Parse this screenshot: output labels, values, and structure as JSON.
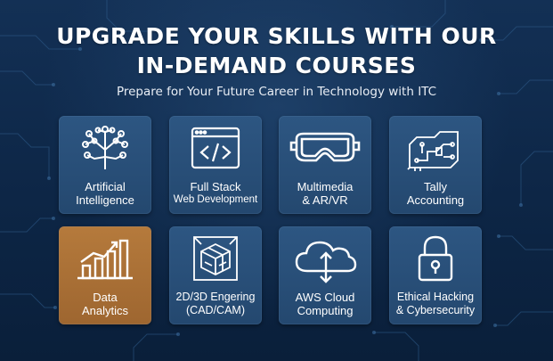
{
  "header": {
    "title_line1": "UPGRADE YOUR SKILLS WITH OUR",
    "title_line2": "IN-DEMAND COURSES",
    "subtitle": "Prepare for Your Future Career in Technology with ITC"
  },
  "courses": [
    {
      "icon": "brain-network-icon",
      "line1": "Artificial",
      "line2": "Intelligence"
    },
    {
      "icon": "code-window-icon",
      "line1": "Full Stack",
      "line2": "Web Development"
    },
    {
      "icon": "vr-headset-icon",
      "line1": "Multimedia",
      "line2": "& AR/VR"
    },
    {
      "icon": "circuit-board-icon",
      "line1": "Tally",
      "line2": "Accounting"
    },
    {
      "icon": "bar-chart-icon",
      "line1": "Data",
      "line2": "Analytics",
      "highlight_color": "#a86d33"
    },
    {
      "icon": "cad-cube-icon",
      "line1": "2D/3D Engering",
      "line2": "(CAD/CAM)"
    },
    {
      "icon": "cloud-upload-icon",
      "line1": "AWS Cloud",
      "line2": "Computing"
    },
    {
      "icon": "padlock-icon",
      "line1": "Ethical Hacking",
      "line2": "& Cybersecurity"
    }
  ],
  "colors": {
    "background": "#0f2a4c",
    "card": "#2a5079",
    "card_highlight": "#a86d33",
    "text": "#ffffff"
  }
}
